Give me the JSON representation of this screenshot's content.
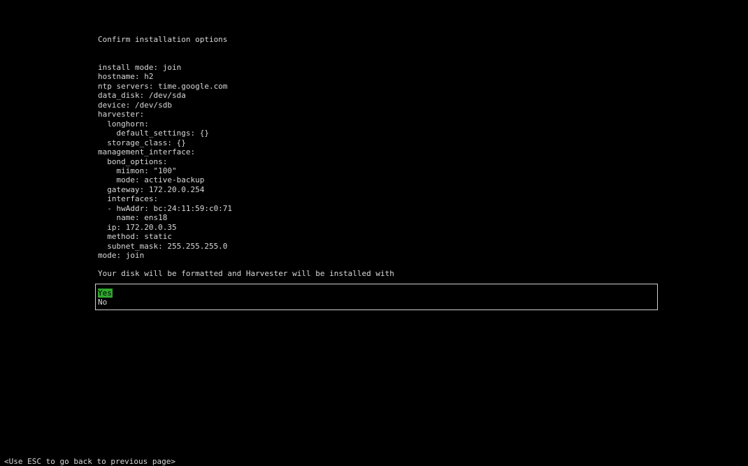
{
  "title": "Confirm installation options",
  "config_lines": [
    "install mode: join",
    "hostname: h2",
    "ntp servers: time.google.com",
    "data_disk: /dev/sda",
    "device: /dev/sdb",
    "harvester:",
    "  longhorn:",
    "    default_settings: {}",
    "  storage_class: {}",
    "management_interface:",
    "  bond_options:",
    "    miimon: \"100\"",
    "    mode: active-backup",
    "  gateway: 172.20.0.254",
    "  interfaces:",
    "  - hwAddr: bc:24:11:59:c0:71",
    "    name: ens18",
    "  ip: 172.20.0.35",
    "  method: static",
    "  subnet_mask: 255.255.255.0",
    "mode: join"
  ],
  "prompt": "Your disk will be formatted and Harvester will be installed with",
  "choices": {
    "yes": "Yes",
    "no": "No",
    "selected": "yes",
    "highlight_color": "#2fa82f"
  },
  "footer": "<Use ESC to go back to previous page>"
}
